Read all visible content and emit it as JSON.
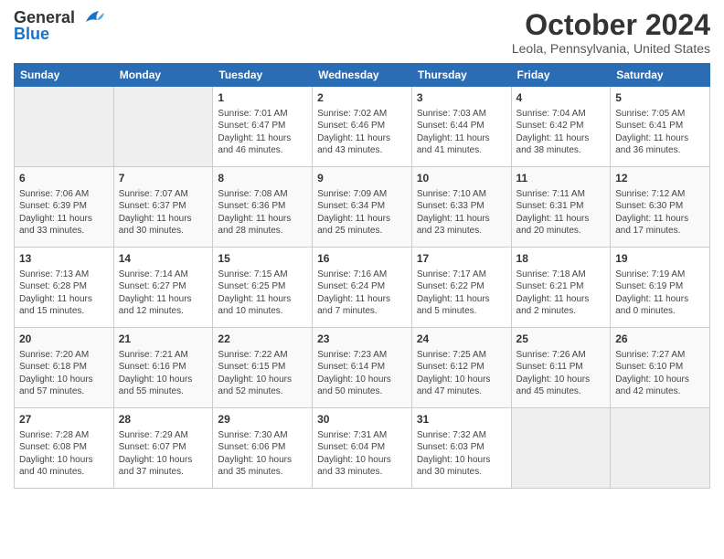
{
  "header": {
    "logo_general": "General",
    "logo_blue": "Blue",
    "month_title": "October 2024",
    "location": "Leola, Pennsylvania, United States"
  },
  "days_of_week": [
    "Sunday",
    "Monday",
    "Tuesday",
    "Wednesday",
    "Thursday",
    "Friday",
    "Saturday"
  ],
  "weeks": [
    [
      {
        "day": "",
        "info": ""
      },
      {
        "day": "",
        "info": ""
      },
      {
        "day": "1",
        "info": "Sunrise: 7:01 AM\nSunset: 6:47 PM\nDaylight: 11 hours and 46 minutes."
      },
      {
        "day": "2",
        "info": "Sunrise: 7:02 AM\nSunset: 6:46 PM\nDaylight: 11 hours and 43 minutes."
      },
      {
        "day": "3",
        "info": "Sunrise: 7:03 AM\nSunset: 6:44 PM\nDaylight: 11 hours and 41 minutes."
      },
      {
        "day": "4",
        "info": "Sunrise: 7:04 AM\nSunset: 6:42 PM\nDaylight: 11 hours and 38 minutes."
      },
      {
        "day": "5",
        "info": "Sunrise: 7:05 AM\nSunset: 6:41 PM\nDaylight: 11 hours and 36 minutes."
      }
    ],
    [
      {
        "day": "6",
        "info": "Sunrise: 7:06 AM\nSunset: 6:39 PM\nDaylight: 11 hours and 33 minutes."
      },
      {
        "day": "7",
        "info": "Sunrise: 7:07 AM\nSunset: 6:37 PM\nDaylight: 11 hours and 30 minutes."
      },
      {
        "day": "8",
        "info": "Sunrise: 7:08 AM\nSunset: 6:36 PM\nDaylight: 11 hours and 28 minutes."
      },
      {
        "day": "9",
        "info": "Sunrise: 7:09 AM\nSunset: 6:34 PM\nDaylight: 11 hours and 25 minutes."
      },
      {
        "day": "10",
        "info": "Sunrise: 7:10 AM\nSunset: 6:33 PM\nDaylight: 11 hours and 23 minutes."
      },
      {
        "day": "11",
        "info": "Sunrise: 7:11 AM\nSunset: 6:31 PM\nDaylight: 11 hours and 20 minutes."
      },
      {
        "day": "12",
        "info": "Sunrise: 7:12 AM\nSunset: 6:30 PM\nDaylight: 11 hours and 17 minutes."
      }
    ],
    [
      {
        "day": "13",
        "info": "Sunrise: 7:13 AM\nSunset: 6:28 PM\nDaylight: 11 hours and 15 minutes."
      },
      {
        "day": "14",
        "info": "Sunrise: 7:14 AM\nSunset: 6:27 PM\nDaylight: 11 hours and 12 minutes."
      },
      {
        "day": "15",
        "info": "Sunrise: 7:15 AM\nSunset: 6:25 PM\nDaylight: 11 hours and 10 minutes."
      },
      {
        "day": "16",
        "info": "Sunrise: 7:16 AM\nSunset: 6:24 PM\nDaylight: 11 hours and 7 minutes."
      },
      {
        "day": "17",
        "info": "Sunrise: 7:17 AM\nSunset: 6:22 PM\nDaylight: 11 hours and 5 minutes."
      },
      {
        "day": "18",
        "info": "Sunrise: 7:18 AM\nSunset: 6:21 PM\nDaylight: 11 hours and 2 minutes."
      },
      {
        "day": "19",
        "info": "Sunrise: 7:19 AM\nSunset: 6:19 PM\nDaylight: 11 hours and 0 minutes."
      }
    ],
    [
      {
        "day": "20",
        "info": "Sunrise: 7:20 AM\nSunset: 6:18 PM\nDaylight: 10 hours and 57 minutes."
      },
      {
        "day": "21",
        "info": "Sunrise: 7:21 AM\nSunset: 6:16 PM\nDaylight: 10 hours and 55 minutes."
      },
      {
        "day": "22",
        "info": "Sunrise: 7:22 AM\nSunset: 6:15 PM\nDaylight: 10 hours and 52 minutes."
      },
      {
        "day": "23",
        "info": "Sunrise: 7:23 AM\nSunset: 6:14 PM\nDaylight: 10 hours and 50 minutes."
      },
      {
        "day": "24",
        "info": "Sunrise: 7:25 AM\nSunset: 6:12 PM\nDaylight: 10 hours and 47 minutes."
      },
      {
        "day": "25",
        "info": "Sunrise: 7:26 AM\nSunset: 6:11 PM\nDaylight: 10 hours and 45 minutes."
      },
      {
        "day": "26",
        "info": "Sunrise: 7:27 AM\nSunset: 6:10 PM\nDaylight: 10 hours and 42 minutes."
      }
    ],
    [
      {
        "day": "27",
        "info": "Sunrise: 7:28 AM\nSunset: 6:08 PM\nDaylight: 10 hours and 40 minutes."
      },
      {
        "day": "28",
        "info": "Sunrise: 7:29 AM\nSunset: 6:07 PM\nDaylight: 10 hours and 37 minutes."
      },
      {
        "day": "29",
        "info": "Sunrise: 7:30 AM\nSunset: 6:06 PM\nDaylight: 10 hours and 35 minutes."
      },
      {
        "day": "30",
        "info": "Sunrise: 7:31 AM\nSunset: 6:04 PM\nDaylight: 10 hours and 33 minutes."
      },
      {
        "day": "31",
        "info": "Sunrise: 7:32 AM\nSunset: 6:03 PM\nDaylight: 10 hours and 30 minutes."
      },
      {
        "day": "",
        "info": ""
      },
      {
        "day": "",
        "info": ""
      }
    ]
  ]
}
